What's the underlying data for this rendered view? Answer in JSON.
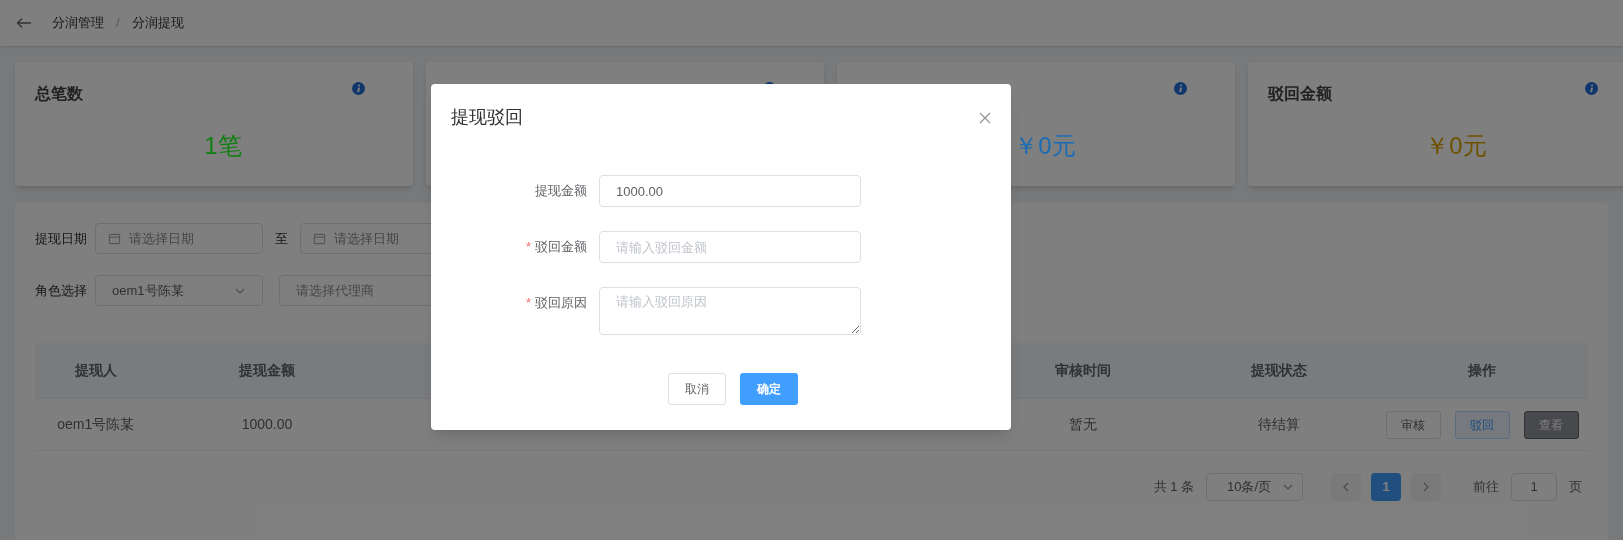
{
  "breadcrumb": [
    "分润管理",
    "分润提现"
  ],
  "breadcrumb_separator": "/",
  "stat_cards": [
    {
      "kind": "stat",
      "title": "总笔数",
      "value": "1笔",
      "color": "#0f800f"
    },
    {
      "kind": "stat"
    },
    {
      "kind": "stat",
      "value": "￥0元",
      "color": "#1a6db4"
    },
    {
      "kind": "stat",
      "title": "驳回金额",
      "value": "￥0元",
      "color": "#6e5200"
    }
  ],
  "filters": {
    "date_label": "提现日期",
    "date_start_placeholder": "请选择日期",
    "date_separator": "至",
    "date_end_placeholder": "请选择日期",
    "role_label": "角色选择",
    "role_value": "oem1号陈某",
    "agent_placeholder": "请选择代理商"
  },
  "table": {
    "columns": [
      "提现人",
      "提现金额",
      null,
      null,
      null,
      "审核时间",
      "提现状态",
      "操作"
    ],
    "rows": [
      {
        "cells": [
          "oem1号陈某",
          "1000.00",
          null,
          null,
          null,
          "暂无",
          "待结算"
        ],
        "actions": [
          {
            "label": "审核",
            "kind": "default"
          },
          {
            "label": "驳回",
            "kind": "primary-plain"
          },
          {
            "label": "查看",
            "kind": "dark"
          }
        ]
      }
    ]
  },
  "pagination": {
    "total": "共 1 条",
    "page_size": "10条/页",
    "pages": [
      {
        "label": "1",
        "selected": true
      }
    ],
    "goto_label": "前往",
    "goto_value": "1",
    "goto_suffix": "页"
  },
  "dialog": {
    "title": "提现驳回",
    "fields": [
      {
        "label": "提现金额",
        "required": false,
        "kind": "input",
        "value": "1000.00"
      },
      {
        "label": "驳回金额",
        "required": true,
        "kind": "input",
        "placeholder": "请输入驳回金额"
      },
      {
        "label": "驳回原因",
        "required": true,
        "kind": "textarea",
        "placeholder": "请输入驳回原因"
      }
    ],
    "required_mark": "*",
    "cancel": "取消",
    "confirm": "确定"
  }
}
